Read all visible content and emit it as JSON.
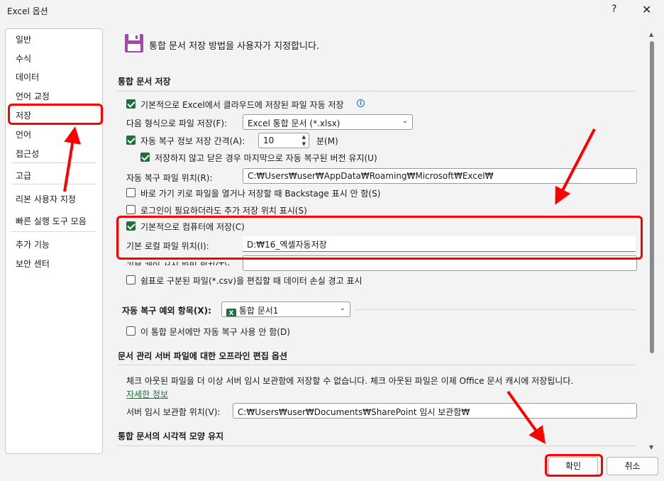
{
  "window": {
    "title": "Excel 옵션",
    "help": "?",
    "close": "✕"
  },
  "sidebar": {
    "items": [
      {
        "label": "일반"
      },
      {
        "label": "수식"
      },
      {
        "label": "데이터"
      },
      {
        "label": "언어 교정"
      },
      {
        "label": "저장",
        "selected": true
      },
      {
        "label": "언어"
      },
      {
        "label": "접근성"
      },
      {
        "label": "고급"
      },
      {
        "label": "리본 사용자 지정"
      },
      {
        "label": "빠른 실행 도구 모음"
      },
      {
        "label": "추가 기능"
      },
      {
        "label": "보안 센터"
      }
    ]
  },
  "header": {
    "text": "통합 문서 저장 방법을 사용자가 지정합니다."
  },
  "save": {
    "heading": "통합 문서 저장",
    "autosave_cloud": "기본적으로 Excel에서 클라우드에 저장된 파일 자동 저장",
    "autosave_checked": true,
    "format_label": "다음 형식으로 파일 저장(F):",
    "format_value": "Excel 통합 문서 (*.xlsx)",
    "autorecover_label": "자동 복구 정보 저장 간격(A):",
    "autorecover_checked": true,
    "autorecover_minutes": "10",
    "minutes_label": "분(M)",
    "keep_last_label": "저장하지 않고 닫은 경우 마지막으로 자동 복구된 버전 유지(U)",
    "keep_last_checked": true,
    "autorecover_location_label": "자동 복구 파일 위치(R):",
    "autorecover_location": "C:₩Users₩user₩AppData₩Roaming₩Microsoft₩Excel₩",
    "backstage_label": "바로 가기 키로 파일을 열거나 저장할 때 Backstage 표시 안 함(S)",
    "backstage_checked": false,
    "login_label": "로그인이 필요하더라도 추가 저장 위치 표시(S)",
    "login_checked": false,
    "save_to_computer_label": "기본적으로 컴퓨터에 저장(C)",
    "save_to_computer_checked": true,
    "default_local_label": "기본 로컬 파일 위치(I):",
    "default_local_value": "D:₩16_엑셀자동저장",
    "personal_template_label": "기본 개인 서식 파일 위치(T):",
    "csv_warning_label": "쉼표로 구분된 파일(*.csv)을 편집할 때 데이터 손실 경고 표시",
    "csv_warning_checked": false
  },
  "autorecover_exceptions": {
    "label": "자동 복구 예외 항목(X):",
    "value": "통합 문서1",
    "disable_label": "이 통합 문서에만 자동 복구 사용 안 함(D)",
    "disable_checked": false
  },
  "offline": {
    "heading": "문서 관리 서버 파일에 대한 오프라인 편집 옵션",
    "desc": "체크 아웃된 파일을 더 이상 서버 임시 보관함에 저장할 수 없습니다. 체크 아웃된 파일은 이제 Office 문서 캐시에 저장됩니다.",
    "more_info": "자세한 정보",
    "drafts_label": "서버 임시 보관함 위치(V):",
    "drafts_value": "C:₩Users₩user₩Documents₩SharePoint 임시 보관함₩"
  },
  "visual": {
    "heading": "통합 문서의 시각적 모양 유지"
  },
  "buttons": {
    "ok": "확인",
    "cancel": "취소"
  },
  "colors": {
    "accent": "#1f6e3b",
    "annotation": "#ff0000"
  }
}
